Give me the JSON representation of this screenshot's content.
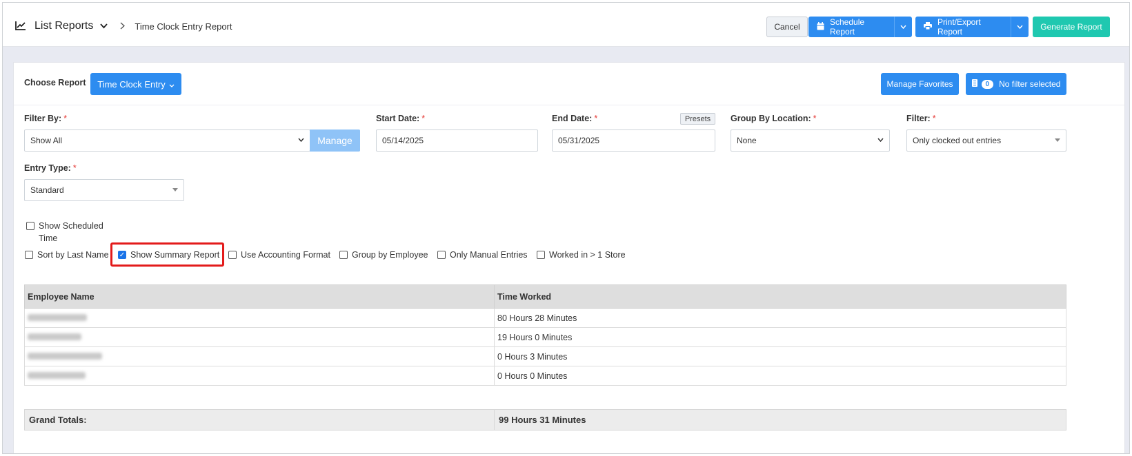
{
  "header": {
    "section_title": "List Reports",
    "page_title": "Time Clock Entry Report",
    "cancel_label": "Cancel",
    "schedule_label": "Schedule Report",
    "print_label": "Print/Export Report",
    "generate_label": "Generate Report"
  },
  "toolbar": {
    "choose_label": "Choose Report",
    "report_name": "Time Clock Entry",
    "favorites_label": "Manage Favorites",
    "filter_count": "0",
    "filter_label": "No filter selected"
  },
  "form": {
    "filter_by_label": "Filter By:",
    "filter_by_value": "Show All",
    "manage_label": "Manage",
    "start_date_label": "Start Date:",
    "start_date_value": "05/14/2025",
    "end_date_label": "End Date:",
    "end_date_value": "05/31/2025",
    "presets_label": "Presets",
    "group_loc_label": "Group By Location:",
    "group_loc_value": "None",
    "filter_label": "Filter:",
    "filter_value": "Only clocked out entries",
    "entry_type_label": "Entry Type:",
    "entry_type_value": "Standard",
    "required_mark": "*"
  },
  "options": {
    "show_scheduled_1": "Show Scheduled",
    "show_scheduled_2": "Time",
    "sort_last_name": "Sort by Last Name",
    "show_summary": "Show Summary Report",
    "accounting": "Use Accounting Format",
    "group_employee": "Group by Employee",
    "manual_entries": "Only Manual Entries",
    "worked_store": "Worked in > 1 Store"
  },
  "table": {
    "col_employee": "Employee Name",
    "col_time": "Time Worked",
    "rows": [
      {
        "time": "80 Hours 28 Minutes"
      },
      {
        "time": "19 Hours 0 Minutes"
      },
      {
        "time": "0 Hours 3 Minutes"
      },
      {
        "time": "0 Hours 0 Minutes"
      }
    ],
    "grand_label": "Grand Totals:",
    "grand_value": "99 Hours 31 Minutes"
  }
}
